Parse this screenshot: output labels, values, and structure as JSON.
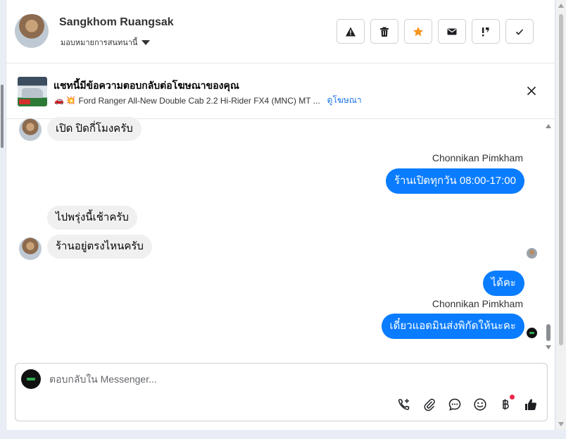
{
  "header": {
    "contact_name": "Sangkhom Ruangsak",
    "assign_label": "มอบหมายการสนทนานี้",
    "actions": [
      {
        "icon": "warning-icon"
      },
      {
        "icon": "trash-icon"
      },
      {
        "icon": "star-icon",
        "color": "#f7931e"
      },
      {
        "icon": "envelope-icon"
      },
      {
        "icon": "priority-icon"
      },
      {
        "icon": "check-icon"
      }
    ]
  },
  "ad_banner": {
    "title": "แชทนี้มีข้อความตอบกลับต่อโฆษณาของคุณ",
    "emoji": "🚗 💥",
    "ad_text": "Ford Ranger All-New Double Cab 2.2 Hi-Rider FX4 (MNC) MT ...",
    "link": "ดูโฆษณา"
  },
  "messages": [
    {
      "direction": "in",
      "text": "เปิด ปิดกี่โมงครับ"
    },
    {
      "direction": "out",
      "sender": "Chonnikan Pimkham",
      "text": "ร้านเปิดทุกวัน 08:00-17:00"
    },
    {
      "direction": "in",
      "text": "ไปพรุ่งนี้เช้าครับ"
    },
    {
      "direction": "in",
      "text": "ร้านอยู่ตรงไหนครับ"
    },
    {
      "direction": "out",
      "text": "ได้คะ"
    },
    {
      "direction": "out",
      "sender": "Chonnikan Pimkham",
      "text": "เดี๋ยวแอดมินส่งพิกัดให้นะคะ"
    }
  ],
  "composer": {
    "placeholder": "ตอบกลับใน Messenger...",
    "tools": [
      "phone-add-icon",
      "attachment-icon",
      "saved-reply-icon",
      "emoji-icon",
      "baht-icon",
      "thumbs-up-icon"
    ]
  },
  "colors": {
    "outgoing_bubble": "#0a7cff",
    "incoming_bubble": "#f0f0f0",
    "link": "#1b74e4"
  }
}
